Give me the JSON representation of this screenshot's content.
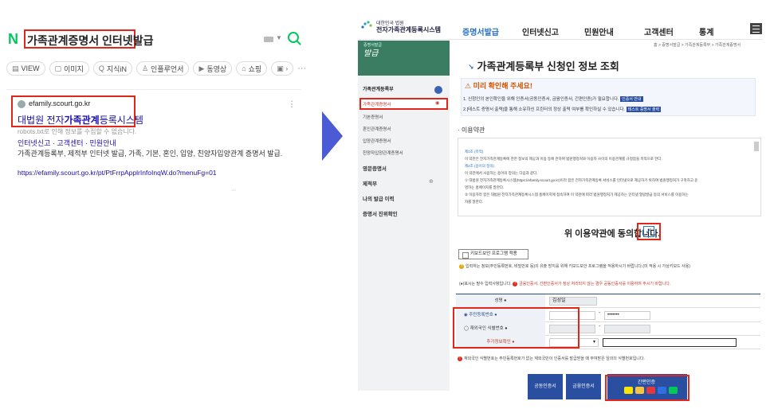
{
  "search": {
    "query": "가족관계증명서 인터넷발급",
    "tabs": [
      "VIEW",
      "이미지",
      "지식iN",
      "인플루언서",
      "동영상",
      "쇼핑"
    ],
    "more": "···"
  },
  "result": {
    "site": "efamily.scourt.go.kr",
    "title": "대법원 전자가족관계등록시스템",
    "robots": "robots.txt로 인해 정보를 수집할 수 없습니다.",
    "sitelinks": "인터넷신고 · 고객센터 · 민원안내",
    "desc": "가족관계등록부, 제적부 인터넷 발급, 가족, 기본, 혼인, 입양, 친양자입양관계 증명서 발급.",
    "url": "https://efamily.scourt.go.kr/pt/PtFrrpApplrInfoInqW.do?menuFg=01",
    "fade": "···"
  },
  "site": {
    "logo_small": "대한민국 법원",
    "logo_name": "전자가족관계등록시스템",
    "nav": [
      "증명서발급",
      "인터넷신고",
      "민원안내",
      "고객센터",
      "통계"
    ],
    "banner_small": "증명서발급",
    "banner": "발급",
    "side_group": "가족관계등록부",
    "side_items": [
      "가족관계증명서",
      "기본증명서",
      "혼인관계증명서",
      "입양관계증명서",
      "친양자입양관계증명서"
    ],
    "side_cats": [
      "영문증명서",
      "제적부",
      "나의 발급 이력",
      "증명서 진위확인"
    ],
    "breadcrumb": "홈 > 증명서발급 > 가족관계등록부 > 가족관계증명서",
    "page_title": "가족관계등록부 신청인 정보 조회",
    "notice_title": "미리 확인해 주세요!",
    "notice_line1": "1. 신청인의 본인확인을 위해 인증서(공동인증서, 금융인증서, 간편인증)가 필요합니다.",
    "notice_tag1": "인증서 안내",
    "notice_line2": "2.[테스트 증명서 출력]을 통해 소유하신 프린터의 정상 출력 여부를 확인하실 수 있습니다.",
    "notice_tag2": "테스트 증명서 출력",
    "terms_title": "이용약관",
    "terms": [
      {
        "text": "제1조 (목적)",
        "h": true
      },
      {
        "text": "이 약관은 전자가족관계등록에 관한 정보의 제공과 이용 등에 관하여 법원행정처와 이용자 사이의 이용관계를 규정함을 목적으로 한다.",
        "h": false
      },
      {
        "text": "제2조 (용어의 정의)",
        "h": true
      },
      {
        "text": "이 약관에서 사용하는 용어의 정의는 다음과 같다.",
        "h": false
      },
      {
        "text": "① 대법원 전자가족관계등록시스템(https://efamily.scourt.go.kr)이라 함은 전자가족관계등록 서비스를 인터넷으로 제공하기 위하여 법원행정처가 구축하고 운",
        "h": false
      },
      {
        "text": "영하는 홈페이지를 말한다.",
        "h": false
      },
      {
        "text": "② 이용자라 함은 대법원 전자가족관계등록시스템 홈페이지에 접속하여 이 약관에 따라 법원행정처가 제공하는 인터넷 열람발급 등의 서비스를 이용하는",
        "h": false
      },
      {
        "text": "자를 말한다.",
        "h": false
      }
    ],
    "agree_text": "위 이용약관에 동의합니다.",
    "agree_check": "✓",
    "keyboard_btn": "키보드보안 프로그램 적용",
    "info1": "입력하는 정보(주민등록번호, 비밀번호 등)의 유출 방지를 위해 키보드보안 프로그램을 적용하시기 바랍니다.(미 적용 시 가상키보드 사용)",
    "info2a": "(●)표시는 필수 입력사항입니다.",
    "info2b": "금융인증서, 간편인증서가 정상 처리되지 않는 경우 공동인증서를 이용하여 주시기 바랍니다.",
    "form": {
      "name_label": "성명 ●",
      "name_value": "김성일",
      "rrn_label": "◉ 주민등록번호 ●",
      "rrn_masked": "•••••••",
      "foreign_label": "◯ 재외국인 식별번호 ●",
      "extra_label": "추가정보확인 ●",
      "extra_select": "▾",
      "dash": "-"
    },
    "bottom_note": "재외국인 식별번호는 주민등록번호가 없는 재외국민이 인증서를 발급받을 때 부여받은 임의의 식별번호입니다.",
    "btn_joint": "공동인증서",
    "btn_finance": "금융인증서",
    "btn_simple": "간편인증"
  }
}
